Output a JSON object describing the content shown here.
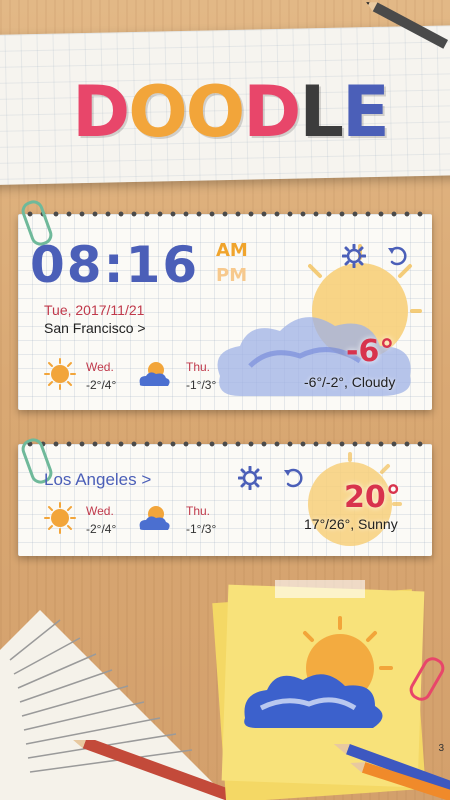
{
  "logo": {
    "letters": [
      "D",
      "O",
      "O",
      "D",
      "L",
      "E"
    ],
    "colors": [
      "#e8466a",
      "#f2a53a",
      "#f2a53a",
      "#e8466a",
      "#3c3c3c",
      "#4b5fb8"
    ]
  },
  "widget1": {
    "time": "08:16",
    "am": "AM",
    "pm": "PM",
    "date": "Tue, 2017/11/21",
    "city": "San Francisco >",
    "current_temp": "-6°",
    "range_condition": "-6°/-2°, Cloudy",
    "forecast": [
      {
        "day": "Wed.",
        "temp": "-2°/4°",
        "icon": "sun-icon"
      },
      {
        "day": "Thu.",
        "temp": "-1°/3°",
        "icon": "cloudy-icon"
      }
    ],
    "settings_icon": "gear-icon",
    "refresh_icon": "refresh-icon"
  },
  "widget2": {
    "city": "Los Angeles >",
    "current_temp": "20°",
    "range_condition": "17°/26°, Sunny",
    "forecast": [
      {
        "day": "Wed.",
        "temp": "-2°/4°",
        "icon": "sun-icon"
      },
      {
        "day": "Thu.",
        "temp": "-1°/3°",
        "icon": "cloudy-icon"
      }
    ],
    "settings_icon": "gear-icon",
    "refresh_icon": "refresh-icon"
  },
  "page_indicator": "3"
}
